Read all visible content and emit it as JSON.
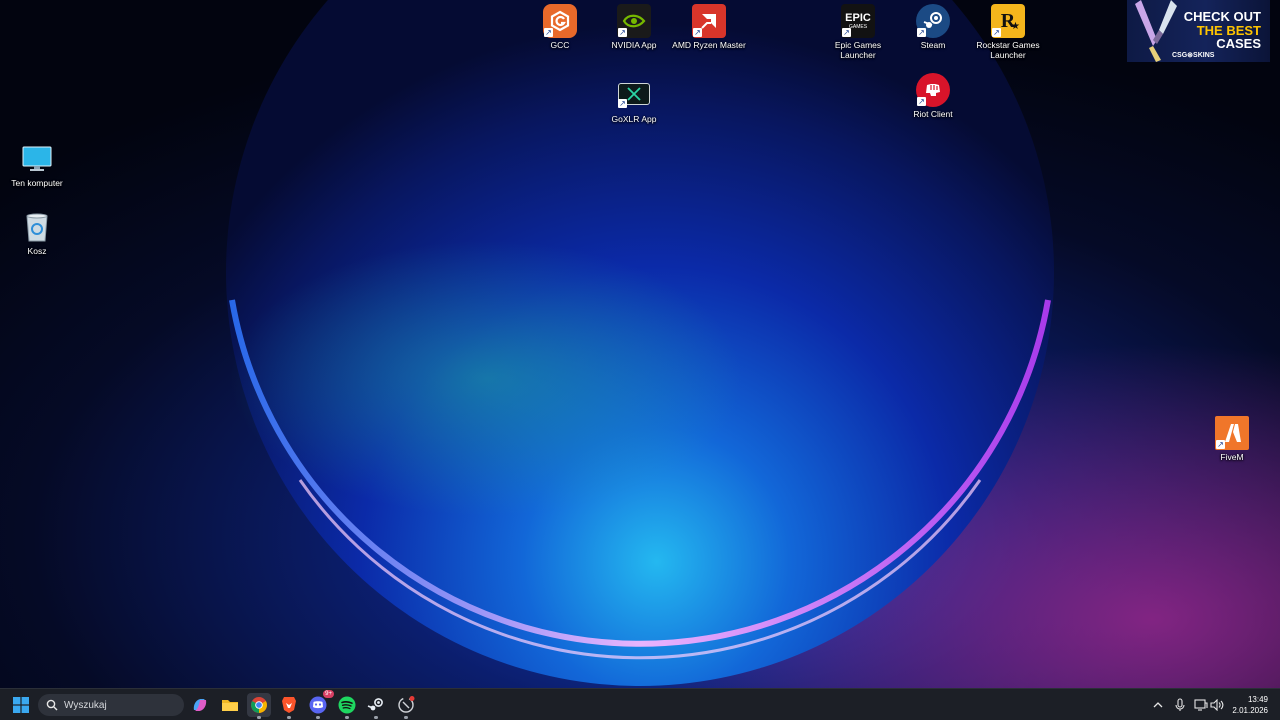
{
  "desktop": {
    "icons": {
      "gcc": "GCC",
      "nvidia": "NVIDIA App",
      "amd": "AMD Ryzen Master",
      "goxlr": "GoXLR App",
      "epic": "Epic Games\nLauncher",
      "steam": "Steam",
      "rockstar": "Rockstar Games\nLauncher",
      "riot": "Riot Client",
      "computer": "Ten komputer",
      "recycle": "Kosz",
      "fivem": "FiveM"
    },
    "epic_tile_text": "EPIC",
    "epic_tile_sub": "GAMES"
  },
  "ad": {
    "line1": "CHECK OUT",
    "line2": "THE BEST",
    "line3": "CASES",
    "brand": "CSG⊛SKINS",
    "colors": {
      "highlight": "#ffc400",
      "background": "#14235a"
    }
  },
  "taskbar": {
    "search_placeholder": "Wyszukaj",
    "discord_badge": "9+",
    "time": "13:49",
    "date": "2.01.2026",
    "apps": [
      "start-icon",
      "copilot-icon",
      "file-explorer-icon",
      "chrome-icon",
      "brave-icon",
      "discord-icon",
      "spotify-icon",
      "steam-icon",
      "riot-icon"
    ],
    "tray": [
      "chevron-up-icon",
      "microphone-icon",
      "display-icon",
      "speaker-icon"
    ]
  }
}
